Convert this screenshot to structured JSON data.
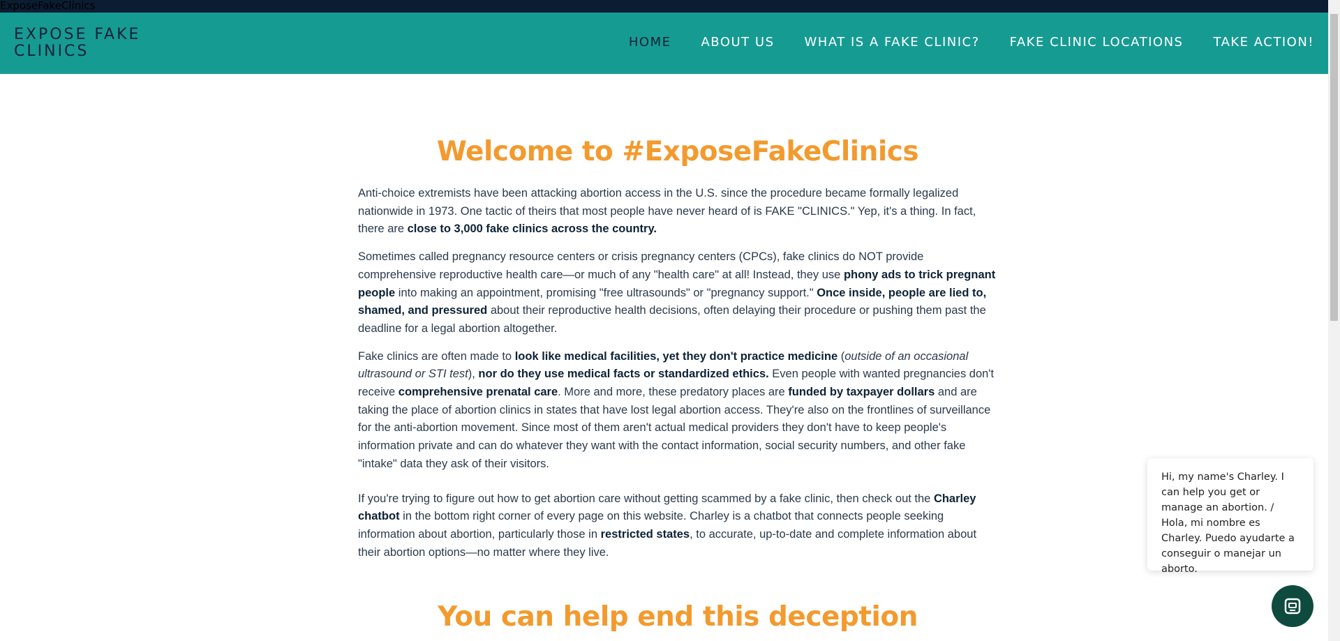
{
  "window_title": "ExposeFakeClinics",
  "header": {
    "logo": "EXPOSE FAKE CLINICS",
    "nav": [
      {
        "label": "HOME"
      },
      {
        "label": "ABOUT US"
      },
      {
        "label": "WHAT IS A FAKE CLINIC?"
      },
      {
        "label": "FAKE CLINIC LOCATIONS"
      },
      {
        "label": "TAKE ACTION!"
      }
    ]
  },
  "main": {
    "welcome_heading": "Welcome to #ExposeFakeClinics",
    "p1": {
      "text": "Anti-choice extremists have been attacking abortion access in the U.S. since the procedure became formally legalized nationwide in 1973. One tactic of theirs that most people have never heard of is FAKE \"CLINICS.\" Yep, it's a thing. In fact, there are ",
      "bold": "close to 3,000 fake clinics across the country."
    },
    "p2": {
      "t1": "Sometimes called pregnancy resource centers or crisis pregnancy centers (CPCs), fake clinics do NOT provide comprehensive reproductive health care—or much of any \"health care\" at all! Instead, they use ",
      "b1": "phony ads to trick pregnant people",
      "t2": " into making an appointment, promising \"free ultrasounds\" or \"pregnancy support.\" ",
      "b2": "Once inside, people are lied to, shamed, and pressured",
      "t3": " about their reproductive health decisions, often delaying their procedure or pushing them past the deadline for a legal abortion altogether."
    },
    "p3": {
      "t1": "Fake clinics are often made to ",
      "b1": "look like medical facilities, yet they don't practice medicine",
      "t2": " (",
      "i1": "outside of an occasional ultrasound or STI test",
      "t3": "), ",
      "b2": "nor do they use medical facts or standardized ethics.",
      "t4": " Even people with wanted pregnancies don't receive ",
      "b3": "comprehensive prenatal care",
      "t5": ". More and more, these predatory places are ",
      "b4": "funded by taxpayer dollars",
      "t6": " and are taking the place of abortion clinics in states that have lost legal abortion access. They're also on the frontlines of surveillance for the anti-abortion movement. Since most of them aren't actual medical providers they don't have to keep people's information private and can do whatever they want with the contact information, social security numbers, and other fake \"intake\" data they ask of their visitors."
    },
    "p4": {
      "t1": "If you're trying to figure out how to get abortion care without getting scammed by a fake clinic, then check out the ",
      "b1": "Charley chatbot",
      "t2": " in the bottom right corner of every page on this website. Charley is a chatbot that connects people seeking information about abortion, particularly those in ",
      "b2": "restricted states",
      "t3": ", to accurate, up-to-date and complete information about their abortion options—no matter where they live."
    },
    "help_heading": "You can help end this deception"
  },
  "chat": {
    "message": "Hi, my name's Charley. I can help you get or manage an abortion. / Hola, mi nombre es Charley. Puedo ayudarte a conseguir o manejar un aborto.",
    "button_icon": "chat-icon"
  },
  "colors": {
    "nav_bg": "#169b93",
    "heading": "#f39a2e",
    "topbar": "#0b1d33",
    "chat_button": "#0f4a3e"
  }
}
